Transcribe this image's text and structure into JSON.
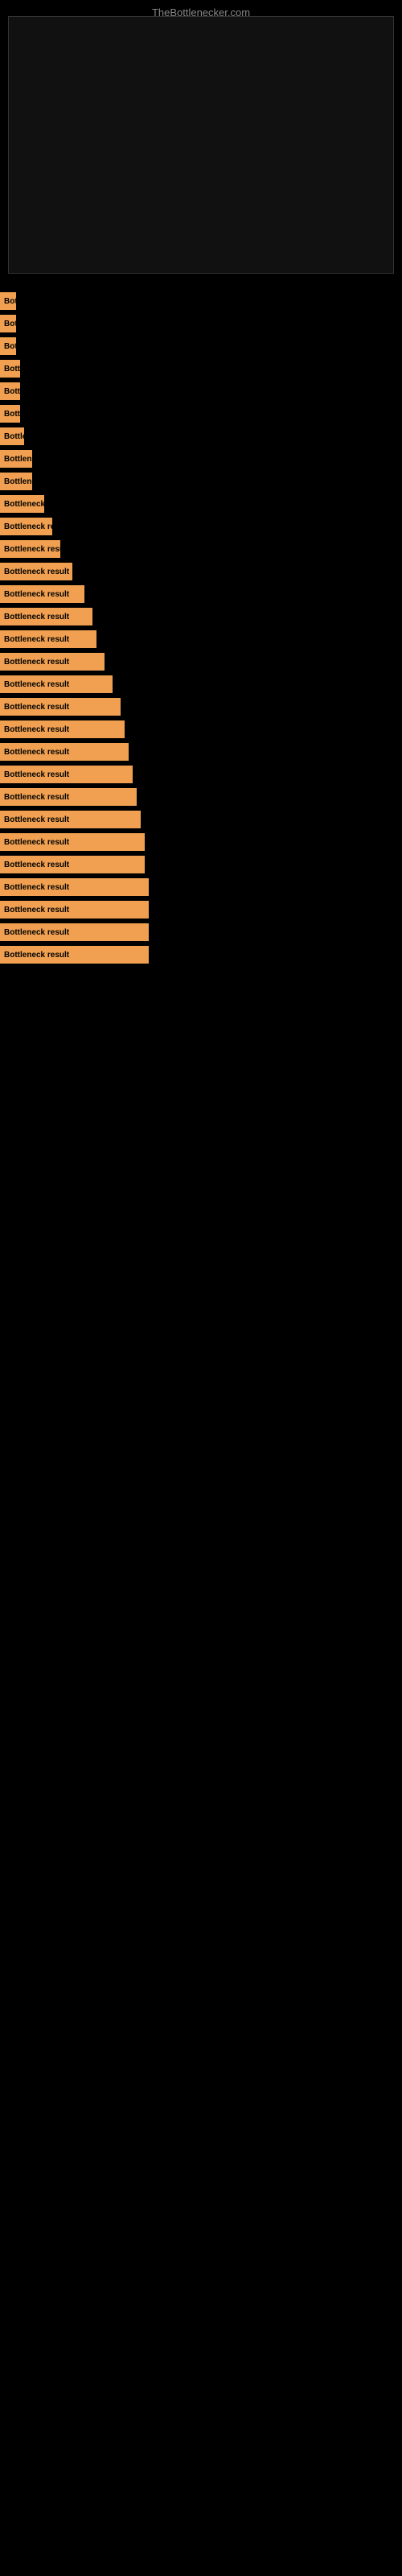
{
  "site": {
    "title": "TheBottlenecker.com"
  },
  "bars": [
    {
      "id": 1,
      "label": "Bottleneck result",
      "width_class": "bar-w-20"
    },
    {
      "id": 2,
      "label": "Bottleneck result",
      "width_class": "bar-w-20"
    },
    {
      "id": 3,
      "label": "Bottleneck result",
      "width_class": "bar-w-20"
    },
    {
      "id": 4,
      "label": "Bottleneck result",
      "width_class": "bar-w-25"
    },
    {
      "id": 5,
      "label": "Bottleneck result",
      "width_class": "bar-w-25"
    },
    {
      "id": 6,
      "label": "Bottleneck result",
      "width_class": "bar-w-25"
    },
    {
      "id": 7,
      "label": "Bottleneck result",
      "width_class": "bar-w-30"
    },
    {
      "id": 8,
      "label": "Bottleneck result",
      "width_class": "bar-w-40"
    },
    {
      "id": 9,
      "label": "Bottleneck result",
      "width_class": "bar-w-40"
    },
    {
      "id": 10,
      "label": "Bottleneck result",
      "width_class": "bar-w-55"
    },
    {
      "id": 11,
      "label": "Bottleneck result",
      "width_class": "bar-w-65"
    },
    {
      "id": 12,
      "label": "Bottleneck result",
      "width_class": "bar-w-75"
    },
    {
      "id": 13,
      "label": "Bottleneck result",
      "width_class": "bar-w-90"
    },
    {
      "id": 14,
      "label": "Bottleneck result",
      "width_class": "bar-w-105"
    },
    {
      "id": 15,
      "label": "Bottleneck result",
      "width_class": "bar-w-115"
    },
    {
      "id": 16,
      "label": "Bottleneck result",
      "width_class": "bar-w-120"
    },
    {
      "id": 17,
      "label": "Bottleneck result",
      "width_class": "bar-w-130"
    },
    {
      "id": 18,
      "label": "Bottleneck result",
      "width_class": "bar-w-140"
    },
    {
      "id": 19,
      "label": "Bottleneck result",
      "width_class": "bar-w-150"
    },
    {
      "id": 20,
      "label": "Bottleneck result",
      "width_class": "bar-w-155"
    },
    {
      "id": 21,
      "label": "Bottleneck result",
      "width_class": "bar-w-160"
    },
    {
      "id": 22,
      "label": "Bottleneck result",
      "width_class": "bar-w-165"
    },
    {
      "id": 23,
      "label": "Bottleneck result",
      "width_class": "bar-w-170"
    },
    {
      "id": 24,
      "label": "Bottleneck result",
      "width_class": "bar-w-175"
    },
    {
      "id": 25,
      "label": "Bottleneck result",
      "width_class": "bar-w-180"
    },
    {
      "id": 26,
      "label": "Bottleneck result",
      "width_class": "bar-w-180"
    },
    {
      "id": 27,
      "label": "Bottleneck result",
      "width_class": "bar-w-185"
    },
    {
      "id": 28,
      "label": "Bottleneck result",
      "width_class": "bar-w-185"
    },
    {
      "id": 29,
      "label": "Bottleneck result",
      "width_class": "bar-w-185"
    },
    {
      "id": 30,
      "label": "Bottleneck result",
      "width_class": "bar-w-185"
    }
  ]
}
